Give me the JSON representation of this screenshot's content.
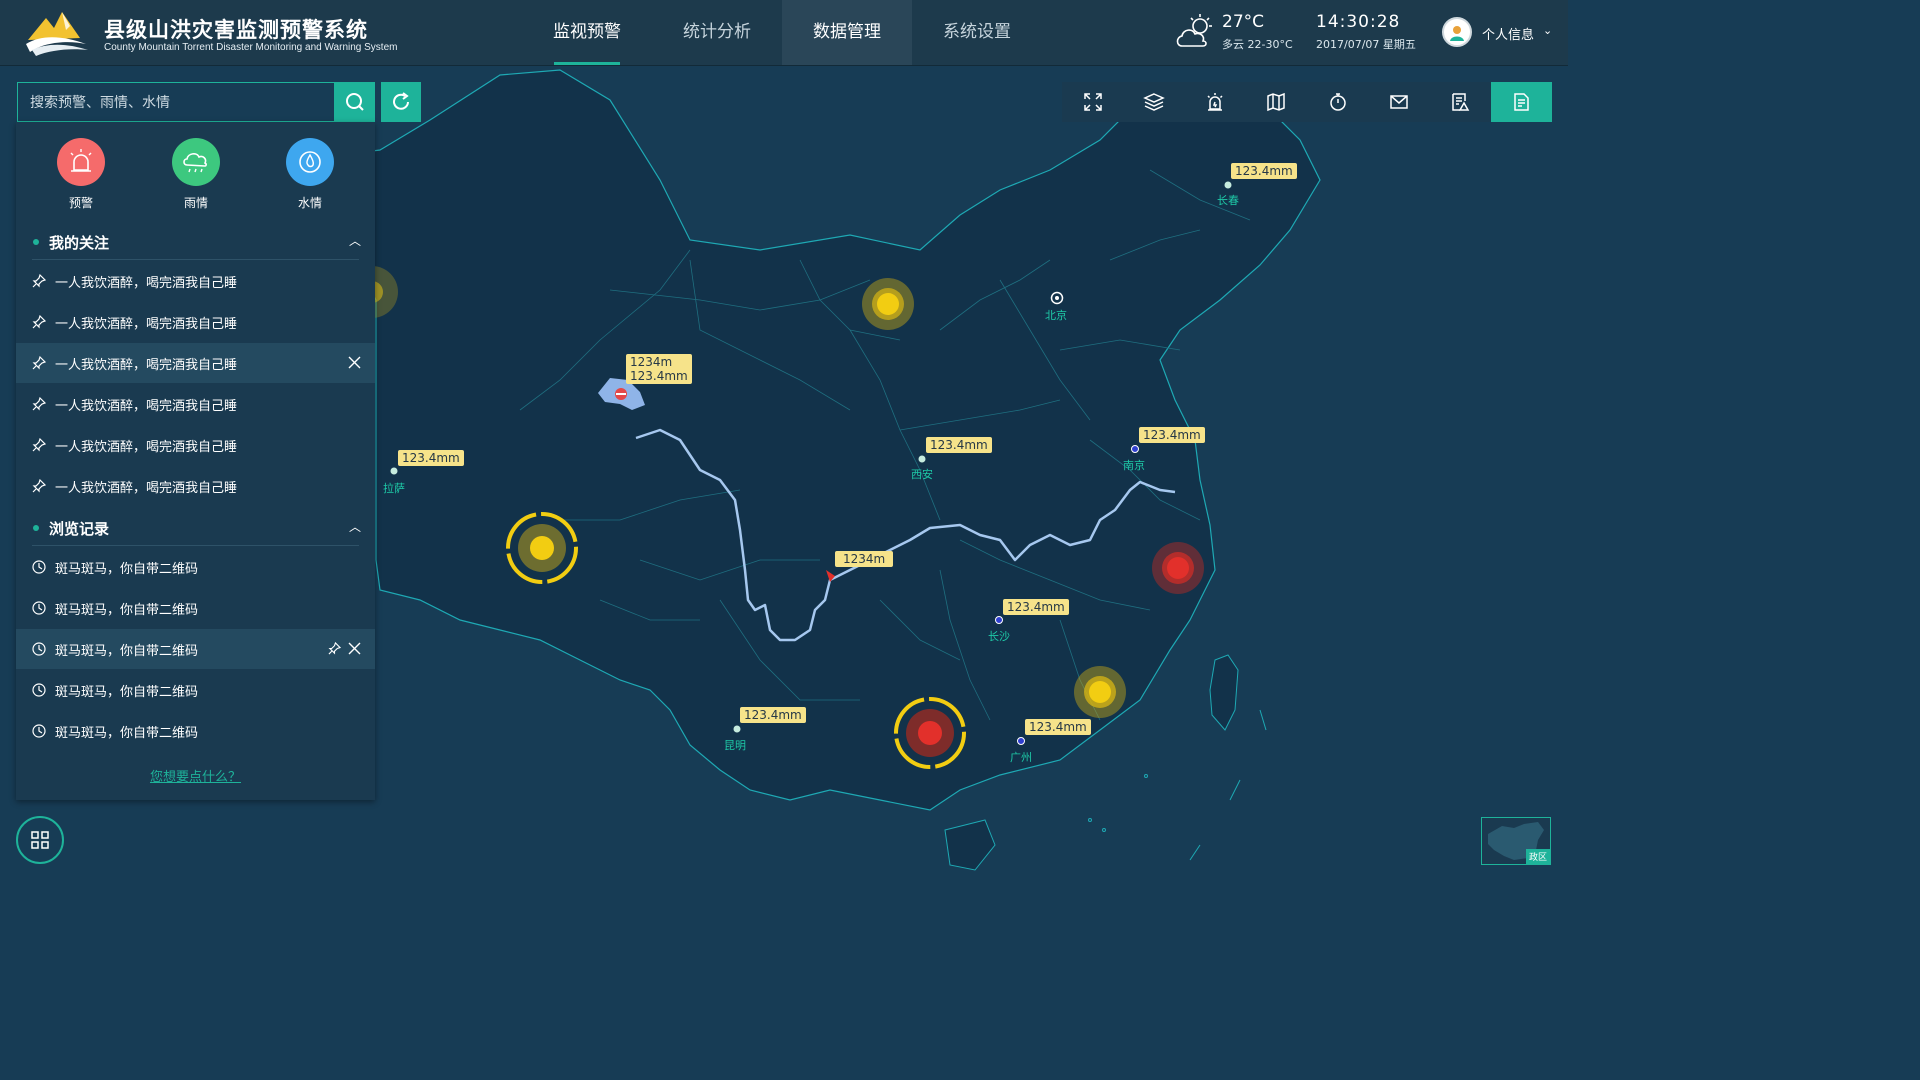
{
  "header": {
    "title": "县级山洪灾害监测预警系统",
    "subtitle": "County Mountain Torrent Disaster Monitoring and Warning System",
    "nav": [
      "监视预警",
      "统计分析",
      "数据管理",
      "系统设置"
    ],
    "weather": {
      "temp": "27°C",
      "desc": "多云 22-30°C",
      "icon": "cloudy-sun-icon"
    },
    "time": "14:30:28",
    "date": "2017/07/07 星期五",
    "user": "个人信息"
  },
  "search": {
    "placeholder": "搜索预警、雨情、水情"
  },
  "categories": [
    {
      "label": "预警",
      "color": "#f56b6b",
      "icon": "alarm-icon"
    },
    {
      "label": "雨情",
      "color": "#3dc87f",
      "icon": "rain-cloud-icon"
    },
    {
      "label": "水情",
      "color": "#3ea7ef",
      "icon": "water-drop-icon"
    }
  ],
  "favorites": {
    "title": "我的关注",
    "items": [
      "一人我饮酒醉，喝完酒我自己睡",
      "一人我饮酒醉，喝完酒我自己睡",
      "一人我饮酒醉，喝完酒我自己睡",
      "一人我饮酒醉，喝完酒我自己睡",
      "一人我饮酒醉，喝完酒我自己睡",
      "一人我饮酒醉，喝完酒我自己睡"
    ]
  },
  "history": {
    "title": "浏览记录",
    "items": [
      "斑马斑马，你自带二维码",
      "斑马斑马，你自带二维码",
      "斑马斑马，你自带二维码",
      "斑马斑马，你自带二维码",
      "斑马斑马，你自带二维码"
    ]
  },
  "suggest_link": "您想要点什么？",
  "toolbar": [
    "fullscreen-icon",
    "layers-icon",
    "alarm-icon",
    "map-icon",
    "timer-icon",
    "mail-icon",
    "report-icon",
    "document-icon"
  ],
  "minimap_label": "政区",
  "map_labels": {
    "changchun": {
      "city": "长春",
      "value": "123.4mm"
    },
    "beijing": {
      "city": "北京"
    },
    "lake": {
      "value1": "1234m",
      "value2": "123.4mm"
    },
    "lasa": {
      "city": "拉萨",
      "value": "123.4mm"
    },
    "xian": {
      "city": "西安",
      "value": "123.4mm"
    },
    "nanjing": {
      "city": "南京",
      "value": "123.4mm"
    },
    "river": {
      "value": "1234m"
    },
    "changsha": {
      "city": "长沙",
      "value": "123.4mm"
    },
    "kunming": {
      "city": "昆明",
      "value": "123.4mm"
    },
    "guangzhou": {
      "city": "广州",
      "value": "123.4mm"
    }
  },
  "colors": {
    "accent": "#1eb39a",
    "map_bg": "#173c55",
    "land": "#12324a",
    "river": "#a6c8ef",
    "warn_yellow": "#f2cd12",
    "warn_red": "#e2302b"
  }
}
